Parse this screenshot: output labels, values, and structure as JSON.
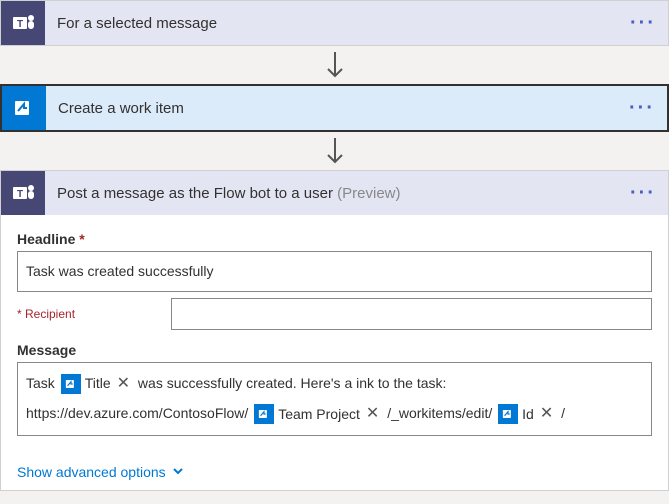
{
  "step1": {
    "title": "For a selected message"
  },
  "step2": {
    "title": "Create a work item"
  },
  "step3": {
    "title": "Post a message as the Flow bot to a user ",
    "preview": "(Preview)",
    "headline_label": "Headline",
    "headline_value": "Task was created successfully",
    "recipient_label": "* Recipient",
    "recipient_value": "",
    "message_label": "Message",
    "msg_text1": "Task",
    "msg_token1": "Title",
    "msg_text2": "was successfully created. Here's a ink to the task:",
    "msg_text3": "https://dev.azure.com/ContosoFlow/",
    "msg_token2": "Team Project",
    "msg_text4": "/_workitems/edit/",
    "msg_token3": "Id",
    "msg_text5": "/"
  },
  "advanced": "Show advanced options"
}
